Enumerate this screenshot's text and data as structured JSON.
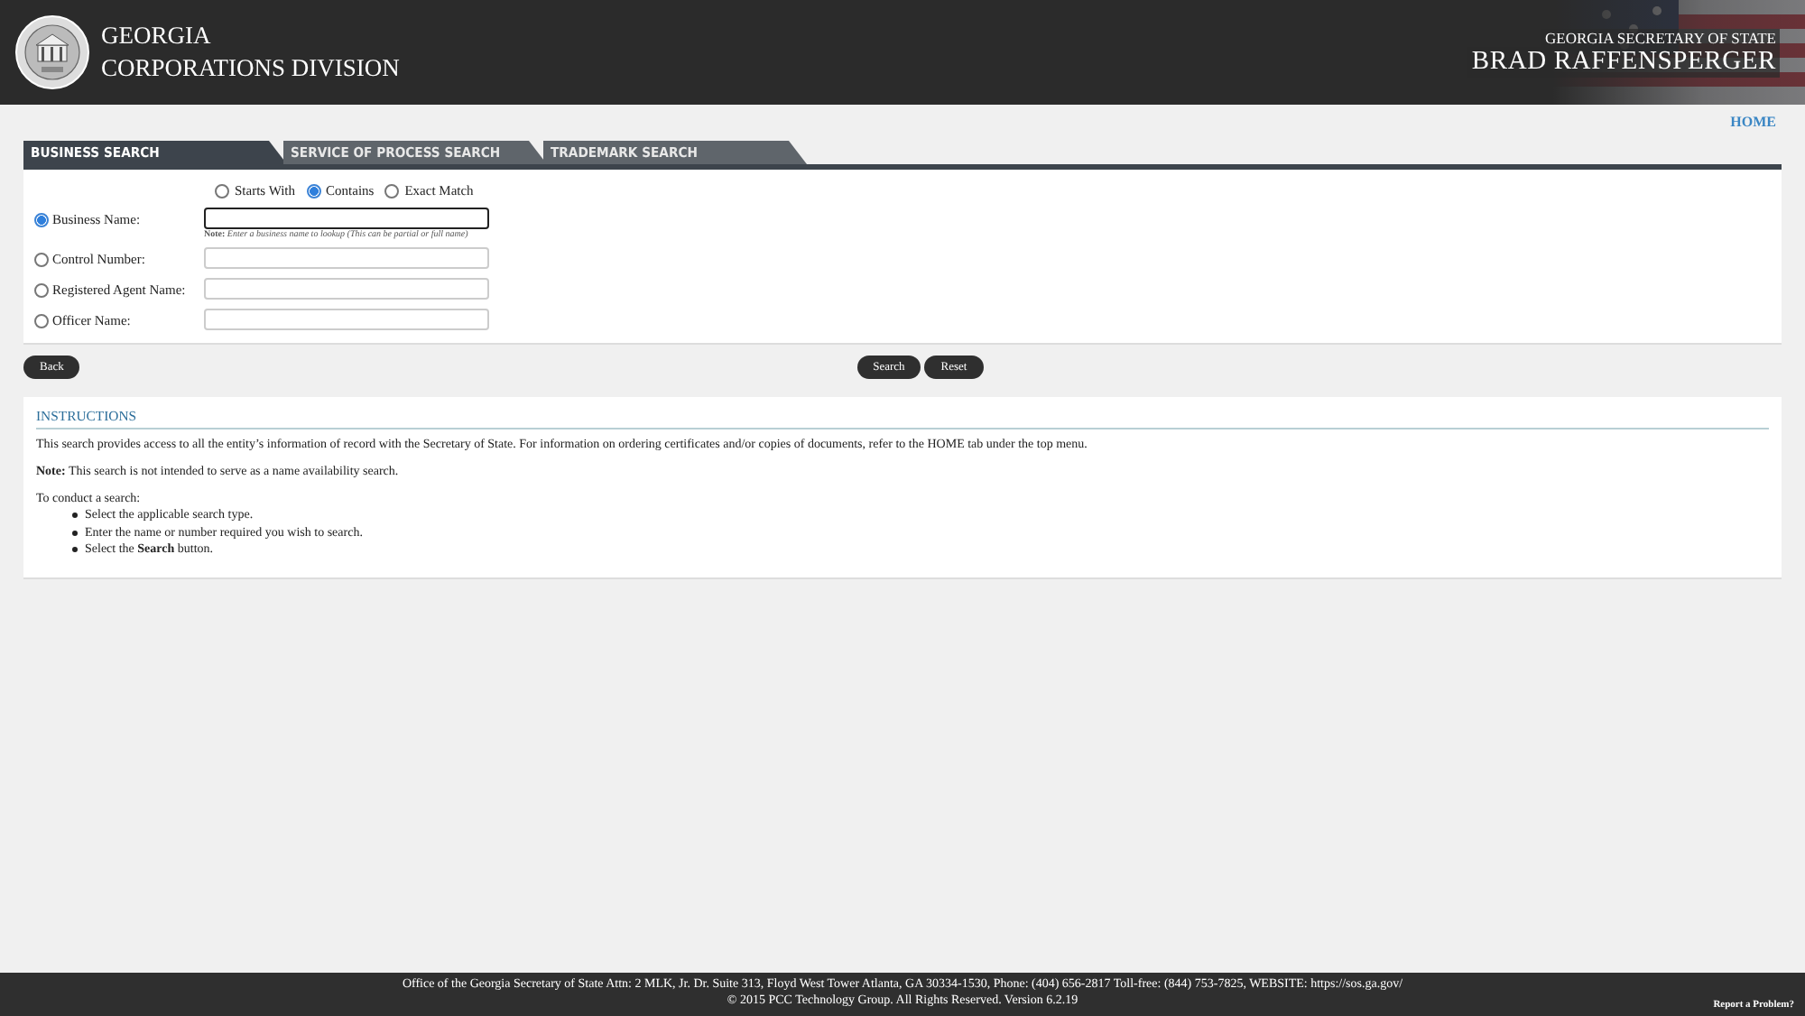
{
  "header": {
    "agency_line1": "GEORGIA",
    "agency_line2": "CORPORATIONS DIVISION",
    "official_title": "GEORGIA SECRETARY OF STATE",
    "official_name": "BRAD RAFFENSPERGER"
  },
  "home_link": "HOME",
  "tabs": [
    {
      "label": "BUSINESS SEARCH",
      "selected": true
    },
    {
      "label": "SERVICE OF PROCESS SEARCH",
      "selected": false
    },
    {
      "label": "TRADEMARK SEARCH",
      "selected": false
    }
  ],
  "match_options": [
    {
      "label": "Starts With",
      "selected": false
    },
    {
      "label": "Contains",
      "selected": true
    },
    {
      "label": "Exact Match",
      "selected": false
    }
  ],
  "search_fields": [
    {
      "label": "Business Name:",
      "selected": true,
      "note": "**Note:** *Enter a business name to lookup (This can be partial or full name)*"
    },
    {
      "label": "Control Number:",
      "selected": false
    },
    {
      "label": "Registered Agent Name:",
      "selected": false
    },
    {
      "label": "Officer Name:",
      "selected": false
    }
  ],
  "buttons": {
    "back": "Back",
    "search": "Search",
    "reset": "Reset"
  },
  "instructions": {
    "title": "INSTRUCTIONS",
    "intro": "This search provides access to all the entity’s information of record with the Secretary of State. For information on ordering certificates and/or copies of documents, refer to the HOME tab under the top menu.",
    "note": "**Note:** This search is not intended to serve as a name availability search.",
    "steps_heading": "To conduct a search:",
    "steps": [
      "Select the applicable search type.",
      "Enter the name or number required you wish to search.",
      "Select the **Search** button."
    ]
  },
  "footer": {
    "address": "Office of the Georgia Secretary of State Attn: 2 MLK, Jr. Dr. Suite 313, Floyd West Tower Atlanta, GA 30334-1530, Phone: (404) 656-2817 Toll-free: (844) 753-7825, WEBSITE: https://sos.ga.gov/",
    "copyright": "© 2015 PCC Technology Group. All Rights Reserved. Version 6.2.19",
    "report_link": "Report a Problem?"
  }
}
